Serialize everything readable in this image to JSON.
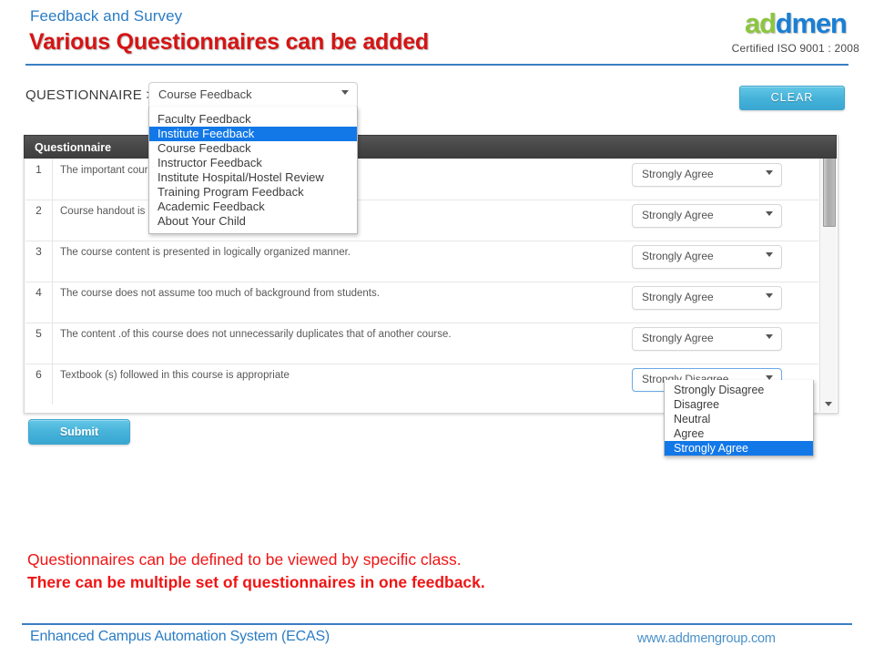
{
  "header": {
    "eyebrow": "Feedback and Survey",
    "title": "Various Questionnaires can be added"
  },
  "logo": {
    "part_green_1": "a",
    "part_green_2": "d",
    "part_blue_1": "d",
    "part_blue_2": "men",
    "iso": "Certified ISO 9001 : 2008",
    "green_hex": "#8cc63f",
    "blue_hex": "#1a7fd4"
  },
  "app": {
    "questionnaire_label": "QUESTIONNAIRE >",
    "questionnaire_select": {
      "value": "Course Feedback",
      "caret": "chevron-down-icon",
      "options": [
        "Faculty Feedback",
        "Institute Feedback",
        "Course Feedback",
        "Instructor Feedback",
        "Institute Hospital/Hostel Review",
        "Training Program Feedback",
        "Academic Feedback",
        "About Your Child"
      ],
      "highlighted": "Institute Feedback"
    },
    "clear_button": "CLEAR",
    "submit_button": "Submit",
    "panel_title": "Questionnaire",
    "rows": [
      {
        "num": "1",
        "text": "The important course    was taught.",
        "answer": "Strongly Agree"
      },
      {
        "num": "2",
        "text": "Course handout is cl",
        "answer": "Strongly Agree"
      },
      {
        "num": "3",
        "text": "The course content is presented in logically organized manner.",
        "answer": "Strongly Agree"
      },
      {
        "num": "4",
        "text": "The course does not assume too much of background from students.",
        "answer": "Strongly Agree"
      },
      {
        "num": "5",
        "text": "The content .of this course does not unnecessarily duplicates that of another course.",
        "answer": "Strongly Agree"
      },
      {
        "num": "6",
        "text": "Textbook (s) followed in this course is appropriate",
        "answer": "Strongly Disagree"
      }
    ],
    "answer_options": [
      "Strongly Disagree",
      "Disagree",
      "Neutral",
      "Agree",
      "Strongly Agree"
    ],
    "answer_highlighted": "Strongly Agree",
    "accent_hex": "#46b2da",
    "highlight_hex": "#1278e8"
  },
  "notes": {
    "line1": "Questionnaires can be defined to be viewed by specific class.",
    "line2": "There can be multiple set of questionnaires in one feedback.",
    "color_hex": "#f01414"
  },
  "footer": {
    "left": "Enhanced Campus Automation System (ECAS)",
    "right": "www.addmengroup.com",
    "rule_hex": "#3b7ec4"
  }
}
